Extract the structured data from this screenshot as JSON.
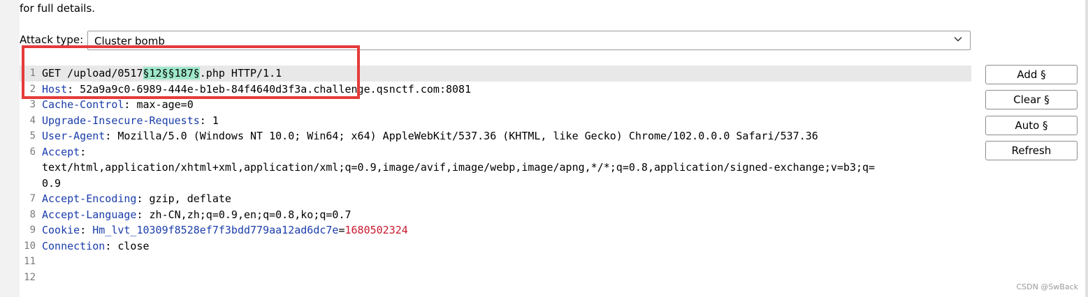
{
  "intro_text": "for full details.",
  "attack_type": {
    "label": "Attack type:",
    "value": "Cluster bomb",
    "chevron_icon": "chevron-down-icon"
  },
  "request": {
    "lines": [
      {
        "num": "1",
        "parts": [
          {
            "t": "GET /upload/0517",
            "c": "plain"
          },
          {
            "t": "§12§",
            "c": "payload"
          },
          {
            "t": "§187§",
            "c": "payload"
          },
          {
            "t": ".php HTTP/1.1",
            "c": "plain"
          }
        ]
      },
      {
        "num": "2",
        "parts": [
          {
            "t": "Host",
            "c": "hname"
          },
          {
            "t": ": 52a9a9c0-6989-444e-b1eb-84f4640d3f3a.challenge.qsnctf.com:8081",
            "c": "plain"
          }
        ]
      },
      {
        "num": "3",
        "parts": [
          {
            "t": "Cache-Control",
            "c": "hname"
          },
          {
            "t": ": max-age=0",
            "c": "plain"
          }
        ]
      },
      {
        "num": "4",
        "parts": [
          {
            "t": "Upgrade-Insecure-Requests",
            "c": "hname"
          },
          {
            "t": ": 1",
            "c": "plain"
          }
        ]
      },
      {
        "num": "5",
        "parts": [
          {
            "t": "User-Agent",
            "c": "hname"
          },
          {
            "t": ": Mozilla/5.0 (Windows NT 10.0; Win64; x64) AppleWebKit/537.36 (KHTML, like Gecko) Chrome/102.0.0.0 Safari/537.36",
            "c": "plain"
          }
        ]
      },
      {
        "num": "6",
        "parts": [
          {
            "t": "Accept",
            "c": "hname"
          },
          {
            "t": ":",
            "c": "plain"
          }
        ]
      },
      {
        "num": "",
        "parts": [
          {
            "t": "text/html,application/xhtml+xml,application/xml;q=0.9,image/avif,image/webp,image/apng,*/*;q=0.8,application/signed-exchange;v=b3;q=",
            "c": "plain"
          }
        ]
      },
      {
        "num": "",
        "parts": [
          {
            "t": "0.9",
            "c": "plain"
          }
        ]
      },
      {
        "num": "7",
        "parts": [
          {
            "t": "Accept-Encoding",
            "c": "hname"
          },
          {
            "t": ": gzip, deflate",
            "c": "plain"
          }
        ]
      },
      {
        "num": "8",
        "parts": [
          {
            "t": "Accept-Language",
            "c": "hname"
          },
          {
            "t": ": zh-CN,zh;q=0.9,en;q=0.8,ko;q=0.7",
            "c": "plain"
          }
        ]
      },
      {
        "num": "9",
        "parts": [
          {
            "t": "Cookie",
            "c": "hname"
          },
          {
            "t": ": ",
            "c": "plain"
          },
          {
            "t": "Hm_lvt_10309f8528ef7f3bdd779aa12ad6dc7e",
            "c": "hname"
          },
          {
            "t": "=",
            "c": "plain"
          },
          {
            "t": "1680502324",
            "c": "cookie-val"
          }
        ]
      },
      {
        "num": "10",
        "parts": [
          {
            "t": "Connection",
            "c": "hname"
          },
          {
            "t": ": close",
            "c": "plain"
          }
        ]
      },
      {
        "num": "11",
        "parts": []
      },
      {
        "num": "12",
        "parts": []
      }
    ]
  },
  "buttons": {
    "add": "Add §",
    "clear": "Clear §",
    "auto": "Auto §",
    "refresh": "Refresh"
  },
  "watermark": "CSDN @SwBack",
  "colors": {
    "header_name": "#1a3caa",
    "cookie_value": "#c8172c",
    "payload_highlight": "#9fe8cc",
    "annotation_box": "#e53b3b"
  }
}
